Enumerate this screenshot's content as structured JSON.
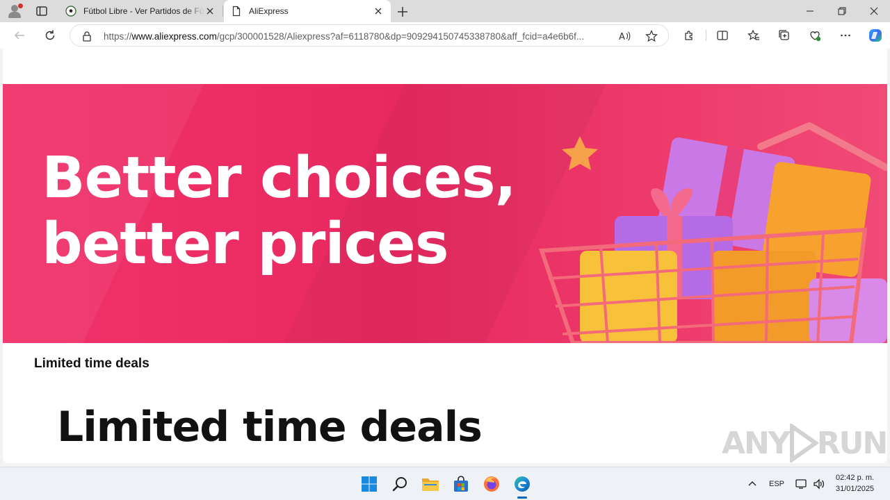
{
  "browser": {
    "tabs": [
      {
        "title": "Fútbol Libre - Ver Partidos de Fútbol",
        "favicon": "soccer-ball-icon",
        "active": false
      },
      {
        "title": "AliExpress",
        "favicon": "page-icon",
        "active": true
      }
    ],
    "url_prefix": "https://",
    "url_domain": "www.aliexpress.com",
    "url_path": "/gcp/300001528/Aliexpress?af=6118780&dp=909294150745338780&aff_fcid=a4e6b6f...",
    "window_controls": [
      "minimize-icon",
      "restore-icon",
      "close-icon"
    ]
  },
  "page": {
    "banner_line1": "Better choices,",
    "banner_line2": "better prices",
    "section_title_small": "Limited time deals",
    "section_title_large": "Limited time deals",
    "watermark": "ANY RUN",
    "colors": {
      "banner": "#f0336a",
      "accent": "#0067c0"
    }
  },
  "taskbar": {
    "apps": [
      "windows-start-icon",
      "search-icon",
      "file-explorer-icon",
      "microsoft-store-icon",
      "firefox-icon",
      "edge-icon"
    ],
    "language": "ESP",
    "time": "02:42 p. m.",
    "date": "31/01/2025"
  }
}
